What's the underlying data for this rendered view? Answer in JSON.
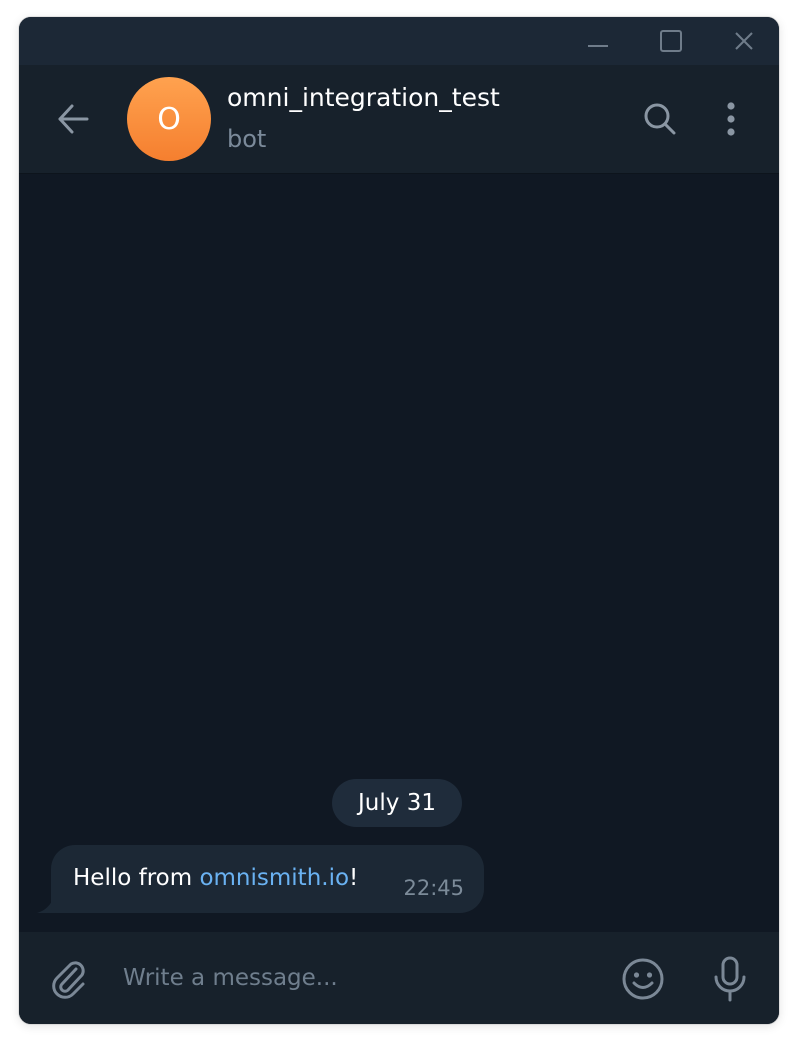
{
  "window": {
    "controls": [
      "minimize",
      "maximize",
      "close"
    ]
  },
  "header": {
    "avatar_letter": "O",
    "title": "omni_integration_test",
    "subtitle": "bot",
    "icons": [
      "back-arrow-icon",
      "search-icon",
      "more-vertical-icon"
    ]
  },
  "messages": {
    "date_separator": "July 31",
    "items": [
      {
        "text_before": "Hello from ",
        "link": "omnismith.io",
        "text_after": "!",
        "time": "22:45"
      }
    ]
  },
  "composer": {
    "placeholder": "Write a message...",
    "icons": [
      "paperclip-icon",
      "emoji-icon",
      "microphone-icon"
    ]
  },
  "colors": {
    "accent_link": "#6ab2f2",
    "avatar_orange": "#f58a36",
    "chat_background": "#101823",
    "header_background": "#17212b"
  }
}
